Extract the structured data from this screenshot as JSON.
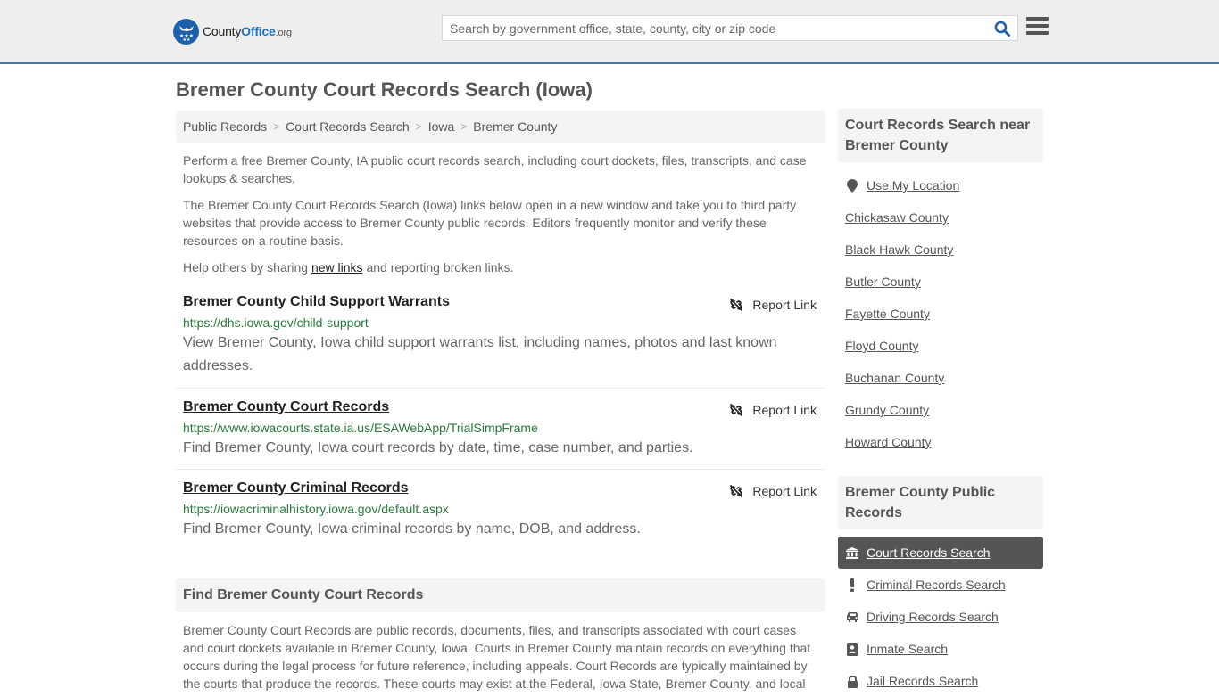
{
  "header": {
    "logo": {
      "brand_part1": "County",
      "brand_part2": "Office",
      "brand_tld": ".org"
    },
    "search": {
      "placeholder": "Search by government office, state, county, city or zip code",
      "value": ""
    },
    "icons": {
      "search": "search-icon",
      "menu": "hamburger-menu-icon"
    }
  },
  "page": {
    "title": "Bremer County Court Records Search (Iowa)"
  },
  "breadcrumb": [
    {
      "label": "Public Records"
    },
    {
      "label": "Court Records Search"
    },
    {
      "label": "Iowa"
    },
    {
      "label": "Bremer County"
    }
  ],
  "intro": {
    "p1": "Perform a free Bremer County, IA public court records search, including court dockets, files, transcripts, and case lookups & searches.",
    "p2": "The Bremer County Court Records Search (Iowa) links below open in a new window and take you to third party websites that provide access to Bremer County public records. Editors frequently monitor and verify these resources on a routine basis.",
    "p3_before": "Help others by sharing ",
    "p3_link": "new links",
    "p3_after": " and reporting broken links."
  },
  "records": [
    {
      "title": "Bremer County Child Support Warrants",
      "url": "https://dhs.iowa.gov/child-support",
      "description": "View Bremer County, Iowa child support warrants list, including names, photos and last known addresses.",
      "report_label": "Report Link"
    },
    {
      "title": "Bremer County Court Records",
      "url": "https://www.iowacourts.state.ia.us/ESAWebApp/TrialSimpFrame",
      "description": "Find Bremer County, Iowa court records by date, time, case number, and parties.",
      "report_label": "Report Link"
    },
    {
      "title": "Bremer County Criminal Records",
      "url": "https://iowacriminalhistory.iowa.gov/default.aspx",
      "description": "Find Bremer County, Iowa criminal records by name, DOB, and address.",
      "report_label": "Report Link"
    }
  ],
  "find_section": {
    "heading": "Find Bremer County Court Records",
    "body": "Bremer County Court Records are public records, documents, files, and transcripts associated with court cases and court dockets available in Bremer County, Iowa. Courts in Bremer County maintain records on everything that occurs during the legal process for future reference, including appeals. Court Records are typically maintained by the courts that produce the records. These courts may exist at the Federal, Iowa State, Bremer County, and local"
  },
  "sidebar": {
    "nearby": {
      "heading": "Court Records Search near Bremer County",
      "use_location": "Use My Location",
      "counties": [
        "Chickasaw County",
        "Black Hawk County",
        "Butler County",
        "Fayette County",
        "Floyd County",
        "Buchanan County",
        "Grundy County",
        "Howard County"
      ]
    },
    "public_records": {
      "heading": "Bremer County Public Records",
      "items": [
        {
          "label": "Court Records Search",
          "icon": "courthouse-icon",
          "active": true
        },
        {
          "label": "Criminal Records Search",
          "icon": "exclamation-icon",
          "active": false
        },
        {
          "label": "Driving Records Search",
          "icon": "car-icon",
          "active": false
        },
        {
          "label": "Inmate Search",
          "icon": "id-badge-icon",
          "active": false
        },
        {
          "label": "Jail Records Search",
          "icon": "lock-icon",
          "active": false
        }
      ]
    }
  },
  "colors": {
    "header_bg": "#eeeeee",
    "header_border": "#3a7dac",
    "brand_blue": "#1d5fa8",
    "url_green": "#2a7a3b",
    "active_item_bg": "#555555",
    "panel_bg": "#f4f4f4"
  }
}
